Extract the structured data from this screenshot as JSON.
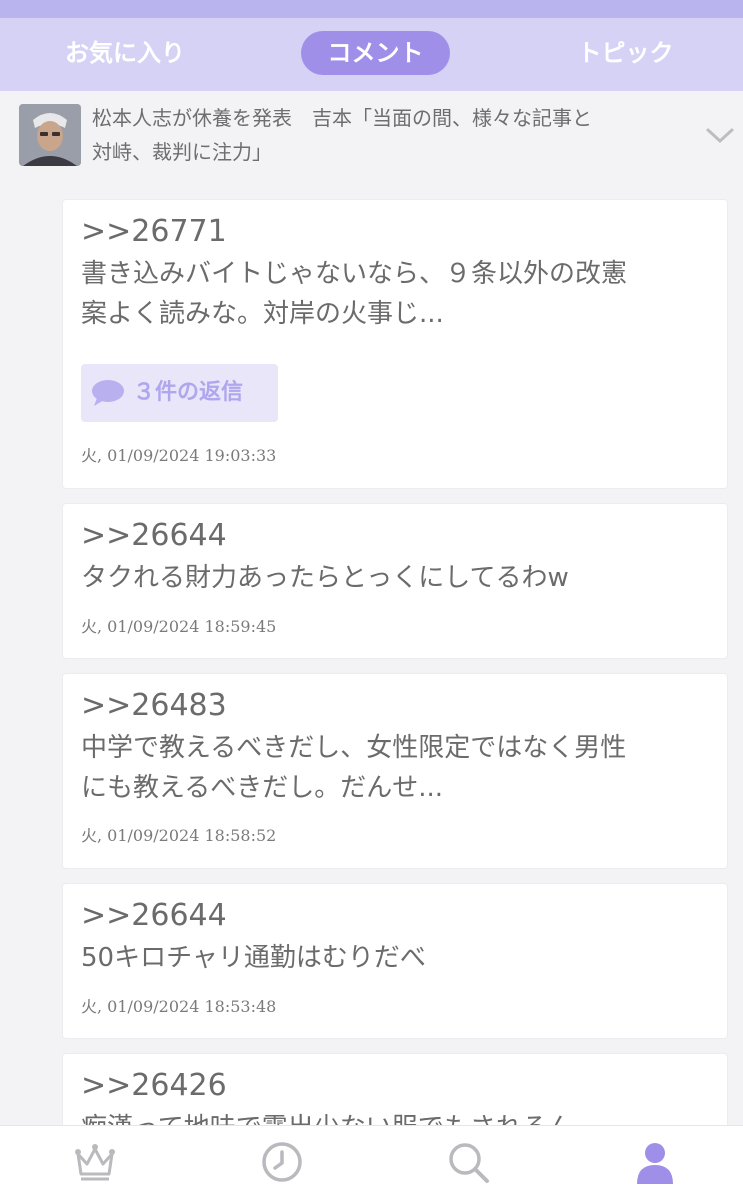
{
  "tabs": {
    "favorites": "お気に入り",
    "comments": "コメント",
    "topics": "トピック"
  },
  "article": {
    "title": "松本人志が休養を発表　吉本「当面の間、様々な記事と\n対峙、裁判に注力」"
  },
  "comments": [
    {
      "ref": ">>26771",
      "text": "書き込みバイトじゃないなら、９条以外の改憲\n案よく読みな。対岸の火事じ...",
      "reply_label": "３件の返信",
      "time": "火, 01/09/2024 19:03:33"
    },
    {
      "ref": ">>26644",
      "text": "タクれる財力あったらとっくにしてるわw",
      "time": "火, 01/09/2024 18:59:45"
    },
    {
      "ref": ">>26483",
      "text": "中学で教えるべきだし、女性限定ではなく男性\nにも教えるべきだし。だんせ...",
      "time": "火, 01/09/2024 18:58:52"
    },
    {
      "ref": ">>26644",
      "text": "50キロチャリ通勤はむりだべ",
      "time": "火, 01/09/2024 18:53:48"
    },
    {
      "ref": ">>26426",
      "text": "痴漢って地味で露出少ない服でもされるん"
    }
  ],
  "bottom_nav": {
    "icons": [
      "crown-icon",
      "clock-icon",
      "search-icon",
      "user-icon"
    ],
    "accent": "#9f8fe8",
    "inactive": "#b9b9be"
  },
  "colors": {
    "tab_bar": "#d6d2f5",
    "active_tab": "#9f8fe8",
    "background": "#f3f3f5"
  }
}
